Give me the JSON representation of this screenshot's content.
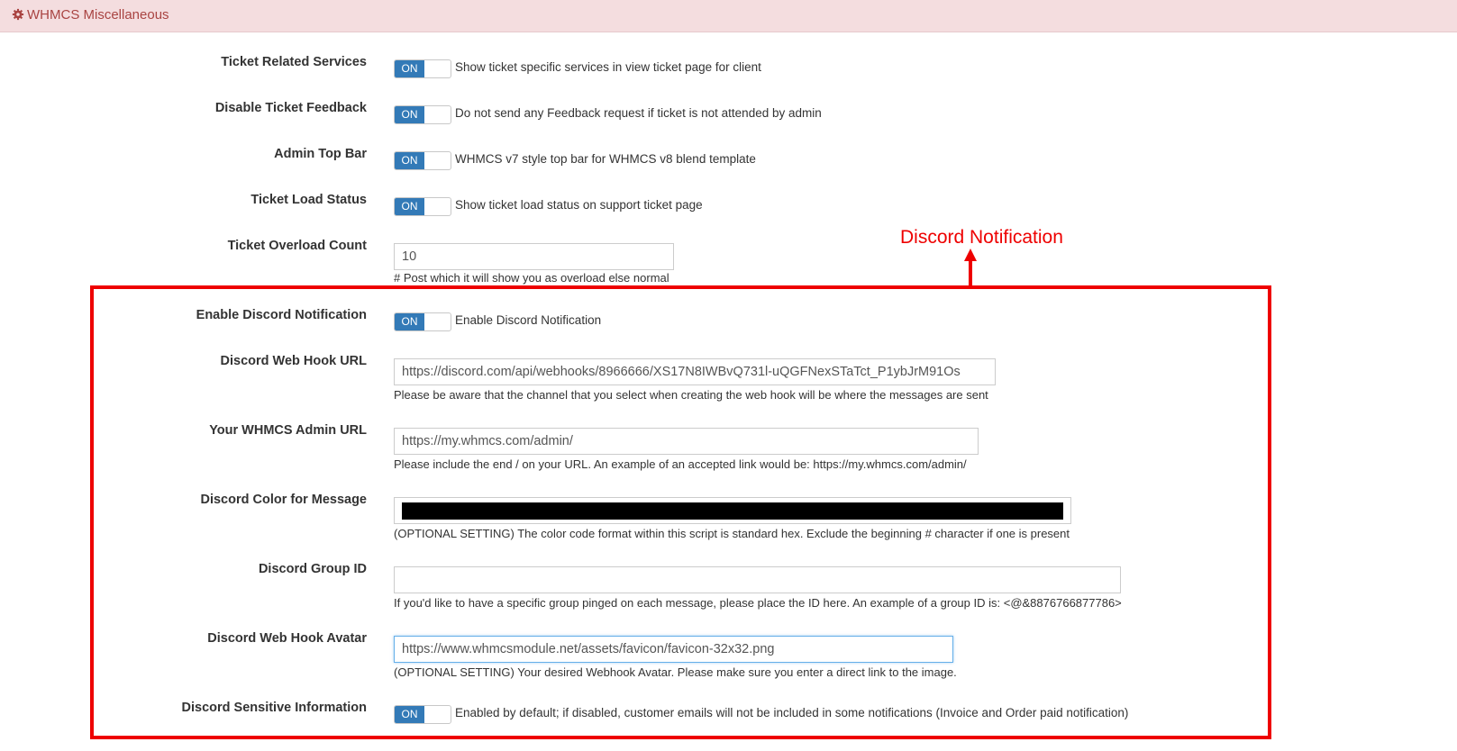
{
  "header": {
    "title": "WHMCS Miscellaneous",
    "icon": "gear-icon"
  },
  "settings": [
    {
      "label": "Ticket Related Services",
      "toggle": "ON",
      "description": "Show ticket specific services in view ticket page for client"
    },
    {
      "label": "Disable Ticket Feedback",
      "toggle": "ON",
      "description": "Do not send any Feedback request if ticket is not attended by admin"
    },
    {
      "label": "Admin Top Bar",
      "toggle": "ON",
      "description": "WHMCS v7 style top bar for WHMCS v8 blend template"
    },
    {
      "label": "Ticket Load Status",
      "toggle": "ON",
      "description": "Show ticket load status on support ticket page"
    },
    {
      "label": "Ticket Overload Count",
      "value": "10",
      "help": "# Post which it will show you as overload else normal"
    },
    {
      "label": "Enable Discord Notification",
      "toggle": "ON",
      "description": "Enable Discord Notification"
    },
    {
      "label": "Discord Web Hook URL",
      "value": "https://discord.com/api/webhooks/8966666/XS17N8IWBvQ731l-uQGFNexSTaTct_P1ybJrM91Os",
      "help": "Please be aware that the channel that you select when creating the web hook will be where the messages are sent"
    },
    {
      "label": "Your WHMCS Admin URL",
      "value": "https://my.whmcs.com/admin/",
      "help": "Please include the end / on your URL. An example of an accepted link would be: https://my.whmcs.com/admin/"
    },
    {
      "label": "Discord Color for Message",
      "color": "#000000",
      "help": "(OPTIONAL SETTING) The color code format within this script is standard hex. Exclude the beginning # character if one is present"
    },
    {
      "label": "Discord Group ID",
      "value": "",
      "help": "If you'd like to have a specific group pinged on each message, please place the ID here. An example of a group ID is: <@&8876766877786>"
    },
    {
      "label": "Discord Web Hook Avatar",
      "value": "https://www.whmcsmodule.net/assets/favicon/favicon-32x32.png",
      "help": "(OPTIONAL SETTING) Your desired Webhook Avatar. Please make sure you enter a direct link to the image."
    },
    {
      "label": "Discord Sensitive Information",
      "toggle": "ON",
      "description": "Enabled by default; if disabled, customer emails will not be included in some notifications (Invoice and Order paid notification)"
    }
  ],
  "annotation": {
    "text": "Discord Notification",
    "color": "#ee0000"
  },
  "colors": {
    "toggle_on": "#337ab7",
    "header_bg": "#f4dddf",
    "header_text": "#a94442"
  }
}
